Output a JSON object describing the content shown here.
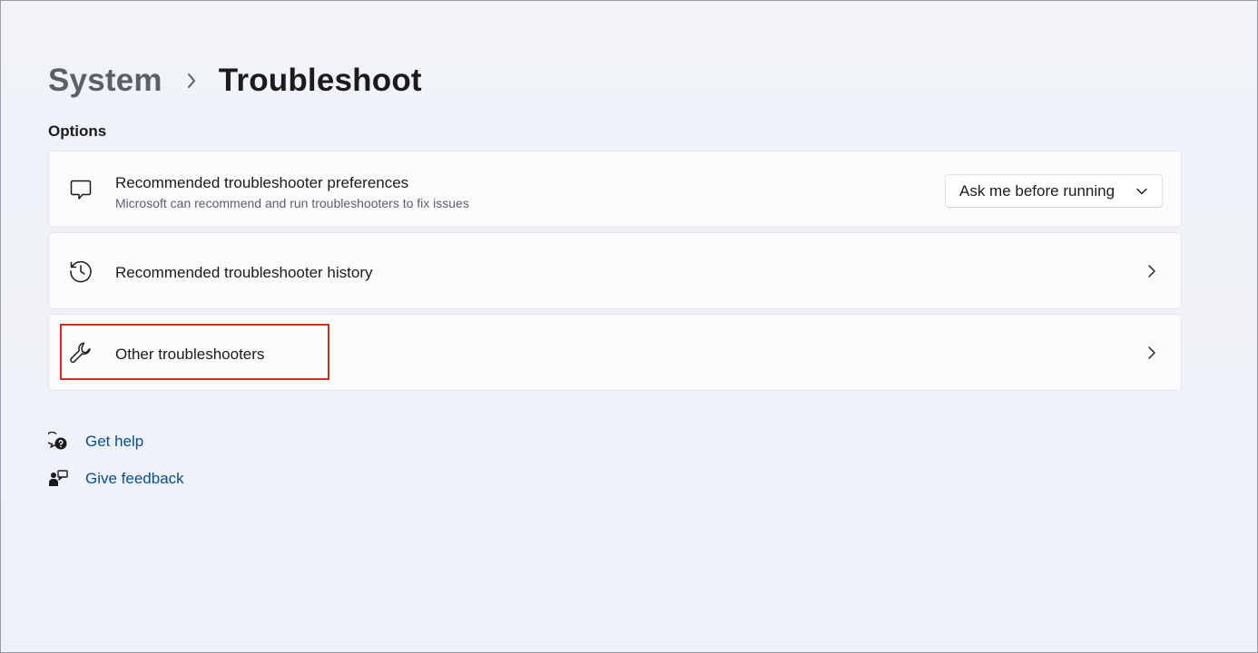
{
  "breadcrumb": {
    "parent": "System",
    "current": "Troubleshoot"
  },
  "options": {
    "section_title": "Options",
    "items": [
      {
        "title": "Recommended troubleshooter preferences",
        "subtitle": "Microsoft can recommend and run troubleshooters to fix issues",
        "icon": "chat-bubble-icon",
        "control": {
          "type": "dropdown",
          "selected": "Ask me before running"
        }
      },
      {
        "title": "Recommended troubleshooter history",
        "icon": "history-icon",
        "control": {
          "type": "chevron"
        }
      },
      {
        "title": "Other troubleshooters",
        "icon": "wrench-icon",
        "control": {
          "type": "chevron"
        },
        "highlighted": true
      }
    ]
  },
  "links": [
    {
      "label": "Get help",
      "icon": "help-chat-icon"
    },
    {
      "label": "Give feedback",
      "icon": "feedback-icon"
    }
  ],
  "colors": {
    "background": "#eef1f8",
    "card": "#fbfbfd",
    "link": "#0b4f8a",
    "highlight": "#d32a2a"
  }
}
